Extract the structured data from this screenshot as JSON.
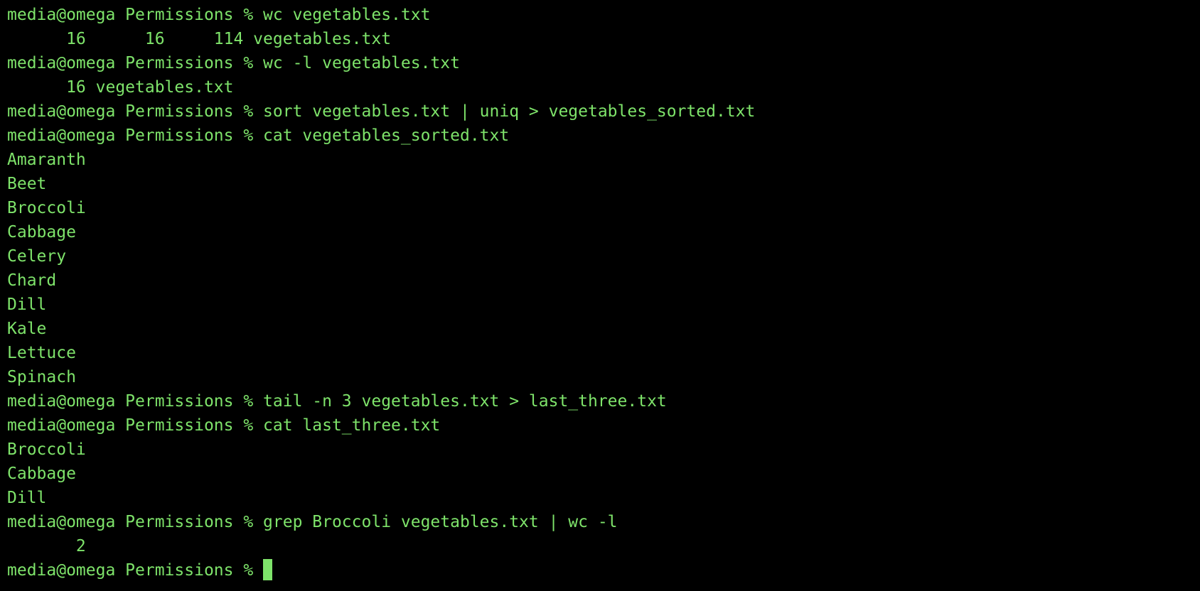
{
  "terminal": {
    "colors": {
      "background": "#000000",
      "text": "#7ee36a",
      "cursor": "#7ee36a"
    },
    "lines": [
      "media@omega Permissions % wc vegetables.txt",
      "      16      16     114 vegetables.txt",
      "media@omega Permissions % wc -l vegetables.txt",
      "      16 vegetables.txt",
      "media@omega Permissions % sort vegetables.txt | uniq > vegetables_sorted.txt",
      "media@omega Permissions % cat vegetables_sorted.txt",
      "Amaranth",
      "Beet",
      "Broccoli",
      "Cabbage",
      "Celery",
      "Chard",
      "Dill",
      "Kale",
      "Lettuce",
      "Spinach",
      "media@omega Permissions % tail -n 3 vegetables.txt > last_three.txt",
      "media@omega Permissions % cat last_three.txt",
      "Broccoli",
      "Cabbage",
      "Dill",
      "media@omega Permissions % grep Broccoli vegetables.txt | wc -l",
      "       2"
    ],
    "prompt": "media@omega Permissions % "
  }
}
